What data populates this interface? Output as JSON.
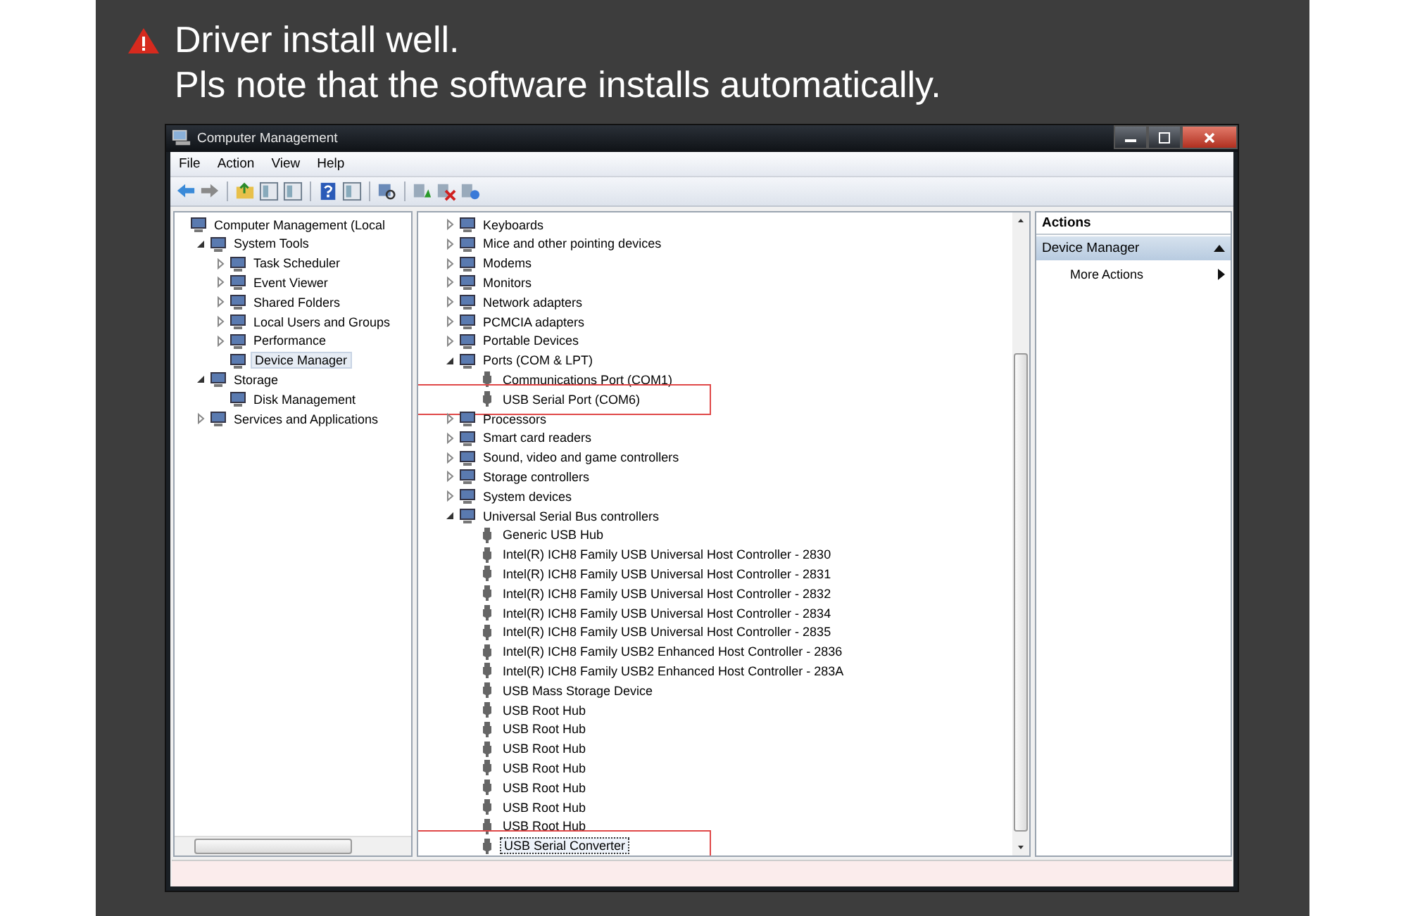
{
  "heading": {
    "lines": [
      "Driver install well.",
      "Pls note that the software installs automatically."
    ]
  },
  "window": {
    "title": "Computer Management"
  },
  "menu": [
    "File",
    "Action",
    "View",
    "Help"
  ],
  "console_tree": [
    {
      "label": "Computer Management (Local",
      "selected": false,
      "children": [
        {
          "label": "System Tools",
          "expanded": true,
          "selected": false,
          "children": [
            {
              "label": "Task Scheduler",
              "expanded": false,
              "selected": false
            },
            {
              "label": "Event Viewer",
              "expanded": false,
              "selected": false
            },
            {
              "label": "Shared Folders",
              "expanded": false,
              "selected": false
            },
            {
              "label": "Local Users and Groups",
              "expanded": false,
              "selected": false
            },
            {
              "label": "Performance",
              "expanded": false,
              "selected": false
            },
            {
              "label": "Device Manager",
              "selected": true
            }
          ]
        },
        {
          "label": "Storage",
          "expanded": true,
          "selected": false,
          "children": [
            {
              "label": "Disk Management",
              "selected": false
            }
          ]
        },
        {
          "label": "Services and Applications",
          "expanded": false,
          "selected": false
        }
      ]
    }
  ],
  "device_tree": [
    {
      "label": "Keyboards",
      "expanded": false,
      "selected": false,
      "highlighted": false
    },
    {
      "label": "Mice and other pointing devices",
      "expanded": false,
      "selected": false,
      "highlighted": false
    },
    {
      "label": "Modems",
      "expanded": false,
      "selected": false,
      "highlighted": false
    },
    {
      "label": "Monitors",
      "expanded": false,
      "selected": false,
      "highlighted": false
    },
    {
      "label": "Network adapters",
      "expanded": false,
      "selected": false,
      "highlighted": false
    },
    {
      "label": "PCMCIA adapters",
      "expanded": false,
      "selected": false,
      "highlighted": false
    },
    {
      "label": "Portable Devices",
      "expanded": false,
      "selected": false,
      "highlighted": false
    },
    {
      "label": "Ports (COM & LPT)",
      "expanded": true,
      "selected": false,
      "highlighted": false,
      "children": [
        {
          "label": "Communications Port (COM1)",
          "selected": false,
          "highlighted": false
        },
        {
          "label": "USB Serial Port (COM6)",
          "selected": false,
          "highlighted": true
        }
      ]
    },
    {
      "label": "Processors",
      "expanded": false,
      "selected": false,
      "highlighted": false
    },
    {
      "label": "Smart card readers",
      "expanded": false,
      "selected": false,
      "highlighted": false
    },
    {
      "label": "Sound, video and game controllers",
      "expanded": false,
      "selected": false,
      "highlighted": false
    },
    {
      "label": "Storage controllers",
      "expanded": false,
      "selected": false,
      "highlighted": false
    },
    {
      "label": "System devices",
      "expanded": false,
      "selected": false,
      "highlighted": false
    },
    {
      "label": "Universal Serial Bus controllers",
      "expanded": true,
      "selected": false,
      "highlighted": false,
      "children": [
        {
          "label": "Generic USB Hub",
          "selected": false,
          "highlighted": false
        },
        {
          "label": "Intel(R) ICH8 Family USB Universal Host Controller - 2830",
          "selected": false,
          "highlighted": false
        },
        {
          "label": "Intel(R) ICH8 Family USB Universal Host Controller - 2831",
          "selected": false,
          "highlighted": false
        },
        {
          "label": "Intel(R) ICH8 Family USB Universal Host Controller - 2832",
          "selected": false,
          "highlighted": false
        },
        {
          "label": "Intel(R) ICH8 Family USB Universal Host Controller - 2834",
          "selected": false,
          "highlighted": false
        },
        {
          "label": "Intel(R) ICH8 Family USB Universal Host Controller - 2835",
          "selected": false,
          "highlighted": false
        },
        {
          "label": "Intel(R) ICH8 Family USB2 Enhanced Host Controller - 2836",
          "selected": false,
          "highlighted": false
        },
        {
          "label": "Intel(R) ICH8 Family USB2 Enhanced Host Controller - 283A",
          "selected": false,
          "highlighted": false
        },
        {
          "label": "USB Mass Storage Device",
          "selected": false,
          "highlighted": false
        },
        {
          "label": "USB Root Hub",
          "selected": false,
          "highlighted": false
        },
        {
          "label": "USB Root Hub",
          "selected": false,
          "highlighted": false
        },
        {
          "label": "USB Root Hub",
          "selected": false,
          "highlighted": false
        },
        {
          "label": "USB Root Hub",
          "selected": false,
          "highlighted": false
        },
        {
          "label": "USB Root Hub",
          "selected": false,
          "highlighted": false
        },
        {
          "label": "USB Root Hub",
          "selected": false,
          "highlighted": false
        },
        {
          "label": "USB Root Hub",
          "selected": false,
          "highlighted": false
        },
        {
          "label": "USB Serial Converter",
          "selected": true,
          "highlighted": true
        }
      ]
    }
  ],
  "actions": {
    "title": "Actions",
    "group": "Device Manager",
    "items": [
      "More Actions"
    ]
  }
}
